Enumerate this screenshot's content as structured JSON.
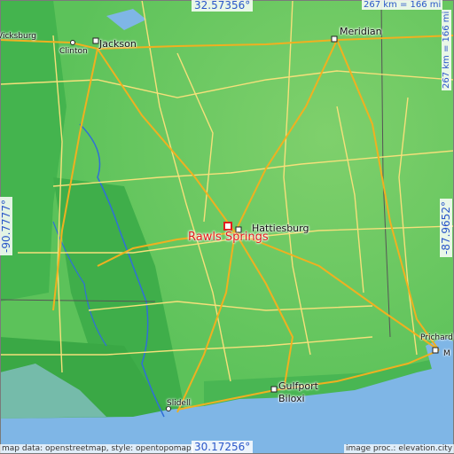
{
  "map": {
    "colors": {
      "lowland": "#3fae4a",
      "midland": "#5cc25a",
      "upland": "#7fd06c",
      "water": "#7fb6e6",
      "river": "#2f6fd8",
      "road_primary": "#f0b020",
      "road_secondary": "#f5e07a",
      "border": "#555555",
      "marker": "#e01e1e",
      "coord_text": "#2a56c9"
    },
    "cities": {
      "jackson": "Jackson",
      "clinton": "Clinton",
      "vicksburg": "Vicksburg",
      "meridian": "Meridian",
      "hattiesburg": "Hattiesburg",
      "prichard": "Prichard",
      "mobile": "M",
      "gulfport": "Gulfport",
      "biloxi": "Biloxi",
      "slidell": "Slidell"
    },
    "marker_label": "Rawls Springs",
    "coords": {
      "top": "32.57356°",
      "bottom": "30.17256°",
      "left": "-90.7777°",
      "right": "-87.9652°"
    },
    "scale": {
      "top": "267 km = 166 mi",
      "right": "267 km = 166 mi"
    },
    "attribution": {
      "left": "map data: openstreetmap, style: opentopomap",
      "right": "image proc.: elevation.city"
    }
  }
}
